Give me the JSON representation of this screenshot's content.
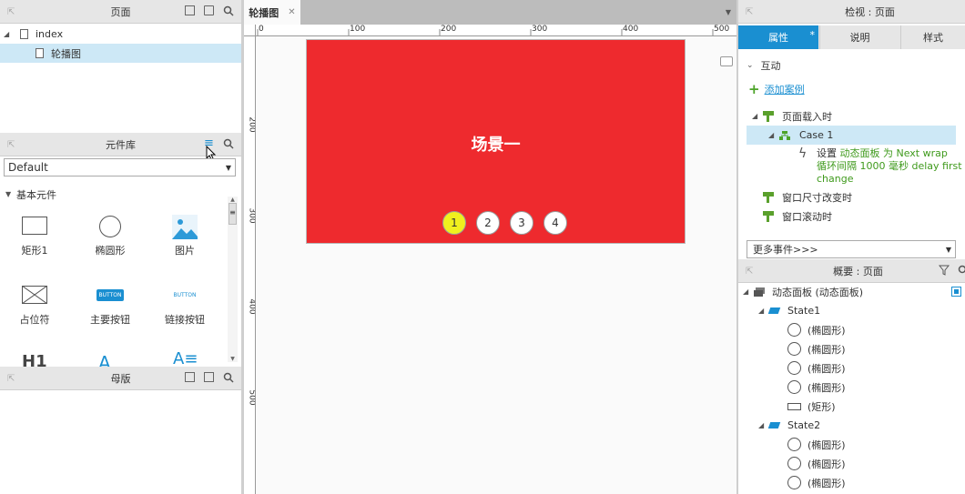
{
  "pages_panel": {
    "title": "页面",
    "items": [
      {
        "label": "index"
      },
      {
        "label": "轮播图"
      }
    ]
  },
  "library_panel": {
    "title": "元件库",
    "library_select": "Default",
    "group_label": "基本元件",
    "widgets": [
      {
        "label": "矩形1",
        "icon": "rectangle-icon"
      },
      {
        "label": "椭圆形",
        "icon": "ellipse-icon"
      },
      {
        "label": "图片",
        "icon": "image-icon"
      },
      {
        "label": "占位符",
        "icon": "placeholder-icon"
      },
      {
        "label": "主要按钮",
        "icon": "primary-button-icon",
        "icon_text": "BUTTON"
      },
      {
        "label": "链接按钮",
        "icon": "link-button-icon",
        "icon_text": "BUTTON"
      }
    ],
    "partial_row": [
      "H1",
      "A",
      "A≡"
    ]
  },
  "masters_panel": {
    "title": "母版"
  },
  "canvas": {
    "tab_label": "轮播图",
    "ruler_x": [
      "0",
      "100",
      "200",
      "300",
      "400",
      "500"
    ],
    "ruler_y": [
      "200",
      "300",
      "400",
      "500"
    ],
    "slide_title": "场景一",
    "dots": [
      "1",
      "2",
      "3",
      "4"
    ],
    "slide_color": "#ee2a2e",
    "active_dot_color": "#f0f01e"
  },
  "inspector": {
    "title": "检视 : 页面",
    "tabs": [
      {
        "label": "属性",
        "badge": "*"
      },
      {
        "label": "说明"
      },
      {
        "label": "样式"
      }
    ],
    "section_label": "互动",
    "add_case": "添加案例",
    "events": [
      {
        "label": "页面载入时"
      },
      {
        "label": "窗口尺寸改变时"
      },
      {
        "label": "窗口滚动时"
      }
    ],
    "case_label": "Case 1",
    "action_prefix": "设置",
    "action_line1": "动态面板 为 Next wrap",
    "action_line2": "循环间隔 1000 毫秒 delay first",
    "action_line3": "change",
    "more_events": "更多事件>>>",
    "accent_color": "#1a8fd1"
  },
  "outline": {
    "title": "概要 : 页面",
    "root": "动态面板 (动态面板)",
    "state1": "State1",
    "state1_items": [
      "(椭圆形)",
      "(椭圆形)",
      "(椭圆形)",
      "(椭圆形)",
      "(矩形)"
    ],
    "state2": "State2",
    "state2_items": [
      "(椭圆形)",
      "(椭圆形)",
      "(椭圆形)"
    ]
  }
}
